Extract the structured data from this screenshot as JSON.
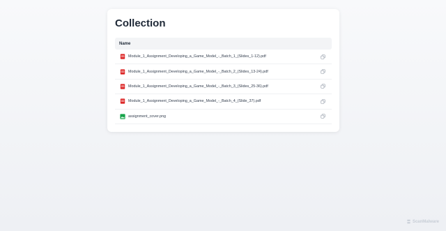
{
  "page": {
    "title": "Collection"
  },
  "table": {
    "header": "Name",
    "rows": [
      {
        "name": "Module_1_Assignment_Developing_a_Game_Model_-_Batch_1_(Slides_1-12).pdf",
        "type": "pdf"
      },
      {
        "name": "Module_1_Assignment_Developing_a_Game_Model_-_Batch_2_(Slides_13-24).pdf",
        "type": "pdf"
      },
      {
        "name": "Module_1_Assignment_Developing_a_Game_Model_-_Batch_3_(Slides_25-36).pdf",
        "type": "pdf"
      },
      {
        "name": "Module_1_Assignment_Developing_a_Game_Model_-_Batch_4_(Slide_37).pdf",
        "type": "pdf"
      },
      {
        "name": "assignment_cover.png",
        "type": "image"
      }
    ]
  },
  "icons": {
    "pdf": "pdf-file-icon",
    "image": "image-file-icon",
    "copy": "copy-icon"
  },
  "colors": {
    "pdf": "#dc2626",
    "image": "#16a34a",
    "copy": "#9ca3af",
    "title": "#1f2937"
  },
  "brand": {
    "name": "ScanMalware"
  }
}
